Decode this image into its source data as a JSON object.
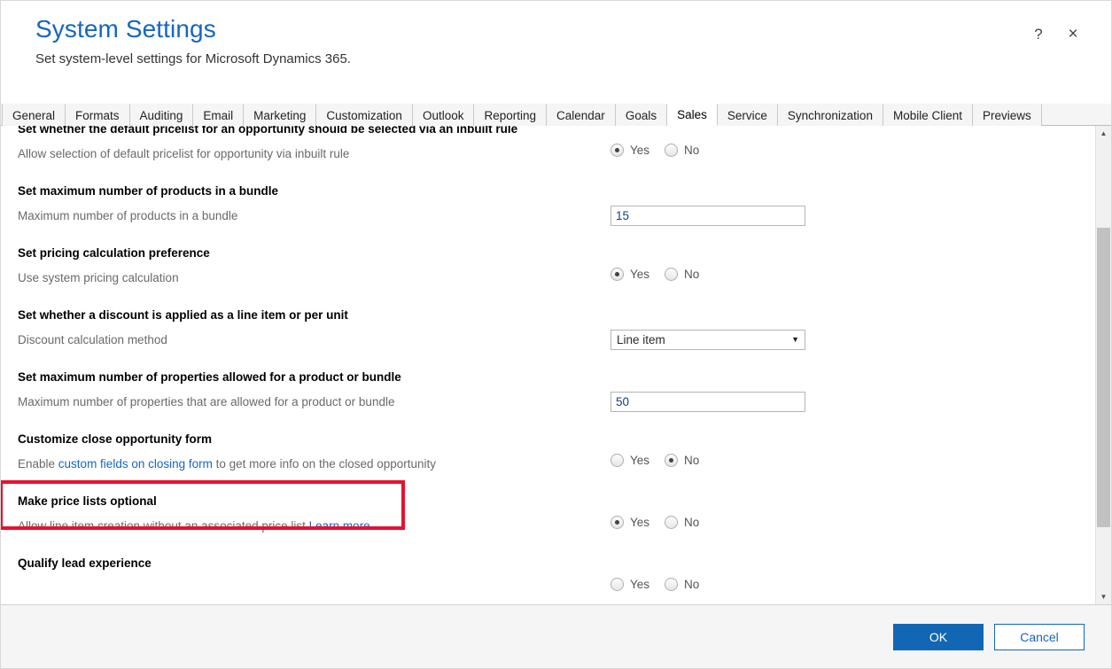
{
  "header": {
    "title": "System Settings",
    "subtitle": "Set system-level settings for Microsoft Dynamics 365.",
    "help_label": "?",
    "close_label": "×"
  },
  "tabs": [
    {
      "label": "General",
      "active": false
    },
    {
      "label": "Formats",
      "active": false
    },
    {
      "label": "Auditing",
      "active": false
    },
    {
      "label": "Email",
      "active": false
    },
    {
      "label": "Marketing",
      "active": false
    },
    {
      "label": "Customization",
      "active": false
    },
    {
      "label": "Outlook",
      "active": false
    },
    {
      "label": "Reporting",
      "active": false
    },
    {
      "label": "Calendar",
      "active": false
    },
    {
      "label": "Goals",
      "active": false
    },
    {
      "label": "Sales",
      "active": true
    },
    {
      "label": "Service",
      "active": false
    },
    {
      "label": "Synchronization",
      "active": false
    },
    {
      "label": "Mobile Client",
      "active": false
    },
    {
      "label": "Previews",
      "active": false
    }
  ],
  "settings": [
    {
      "title": "Set whether the default pricelist for an opportunity should be selected via an inbuilt rule",
      "desc_before": "Allow selection of default pricelist for opportunity via inbuilt rule",
      "link": "",
      "desc_after": "",
      "control": "radio",
      "yes_label": "Yes",
      "no_label": "No",
      "selected": "Yes"
    },
    {
      "title": "Set maximum number of products in a bundle",
      "desc_before": "Maximum number of products in a bundle",
      "link": "",
      "desc_after": "",
      "control": "text",
      "value": "15"
    },
    {
      "title": "Set pricing calculation preference",
      "desc_before": "Use system pricing calculation",
      "link": "",
      "desc_after": "",
      "control": "radio",
      "yes_label": "Yes",
      "no_label": "No",
      "selected": "Yes"
    },
    {
      "title": "Set whether a discount is applied as a line item or per unit",
      "desc_before": "Discount calculation method",
      "link": "",
      "desc_after": "",
      "control": "dropdown",
      "value": "Line item",
      "caret": "▼"
    },
    {
      "title": "Set maximum number of properties allowed for a product or bundle",
      "desc_before": "Maximum number of properties that are allowed for a product or bundle",
      "link": "",
      "desc_after": "",
      "control": "text",
      "value": "50"
    },
    {
      "title": "Customize close opportunity form",
      "desc_before": "Enable ",
      "link": "custom fields on closing form",
      "desc_after": " to get more info on the closed opportunity",
      "control": "radio",
      "yes_label": "Yes",
      "no_label": "No",
      "selected": "No"
    },
    {
      "title": "Make price lists optional",
      "desc_before": "Allow line item creation without an associated price list ",
      "link": "Learn more",
      "desc_after": "",
      "control": "radio",
      "yes_label": "Yes",
      "no_label": "No",
      "selected": "Yes",
      "highlighted": true
    },
    {
      "title": "Qualify lead experience",
      "desc_before": "",
      "link": "",
      "desc_after": "",
      "control": "radio",
      "yes_label": "Yes",
      "no_label": "No",
      "selected": "none"
    }
  ],
  "scrollbar": {
    "up_arrow": "▲",
    "down_arrow": "▼"
  },
  "footer": {
    "ok_label": "OK",
    "cancel_label": "Cancel"
  },
  "colors": {
    "accent_blue": "#1666c0",
    "primary_button": "#1267b5",
    "highlight_red": "#e8112d",
    "link_blue": "#1666c0"
  }
}
